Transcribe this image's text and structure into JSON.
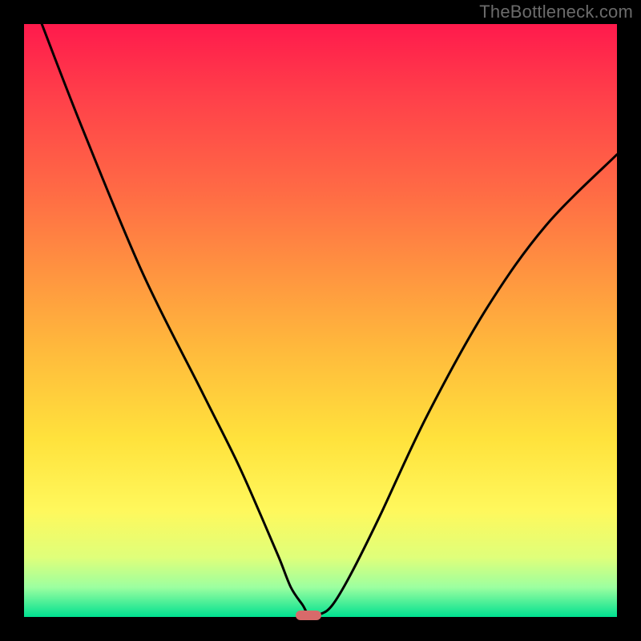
{
  "watermark": "TheBottleneck.com",
  "chart_data": {
    "type": "line",
    "title": "",
    "xlabel": "",
    "ylabel": "",
    "xlim": [
      0,
      100
    ],
    "ylim": [
      0,
      100
    ],
    "series": [
      {
        "name": "curve",
        "x": [
          3,
          10,
          20,
          30,
          36,
          40,
          43,
          45,
          47,
          48,
          50,
          52,
          55,
          60,
          68,
          78,
          88,
          100
        ],
        "values": [
          100,
          82,
          58,
          38,
          26,
          17,
          10,
          5,
          2,
          0.5,
          0.5,
          2,
          7,
          17,
          34,
          52,
          66,
          78
        ]
      }
    ],
    "marker": {
      "x": 48,
      "y": 0,
      "color": "#d86a6a"
    },
    "gradient_stops": [
      {
        "pct": 0,
        "color": "#ff1a4c"
      },
      {
        "pct": 28,
        "color": "#ff6a45"
      },
      {
        "pct": 55,
        "color": "#ffba3c"
      },
      {
        "pct": 82,
        "color": "#fff85c"
      },
      {
        "pct": 95,
        "color": "#9cffa0"
      },
      {
        "pct": 100,
        "color": "#00e090"
      }
    ]
  }
}
